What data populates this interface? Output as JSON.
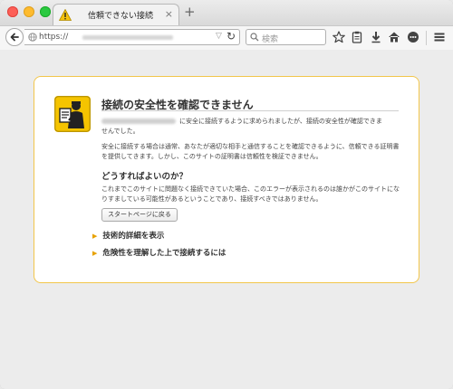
{
  "tab": {
    "title": "信頼できない接続",
    "close": "×",
    "new_tab": "+"
  },
  "navbar": {
    "url_prefix": "https://",
    "search_placeholder": "検索"
  },
  "error_page": {
    "title": "接続の安全性を確認できません",
    "paragraph1_line1": "に安全に接続するように求められましたが、接続の安全性が確認できま",
    "paragraph1_line2": "せんでした。",
    "paragraph2": "安全に接続する場合は通常、あなたが適切な相手と通信することを確認できるように、信頼できる証明書を提供してきます。しかし、このサイトの証明書は信頼性を検証できません。",
    "heading": "どうすればよいのか？",
    "paragraph3": "これまでこのサイトに問題なく接続できていた場合、このエラーが表示されるのは誰かがこのサイトになりすましている可能性があるということであり、接続すべきではありません。",
    "button_label": "スタートページに戻る",
    "expander1": "技術的詳細を表示",
    "expander2": "危険性を理解した上で接続するには",
    "expander_glyph": "▶"
  },
  "colors": {
    "accent": "#f2c64b",
    "warning": "#e7a100"
  }
}
